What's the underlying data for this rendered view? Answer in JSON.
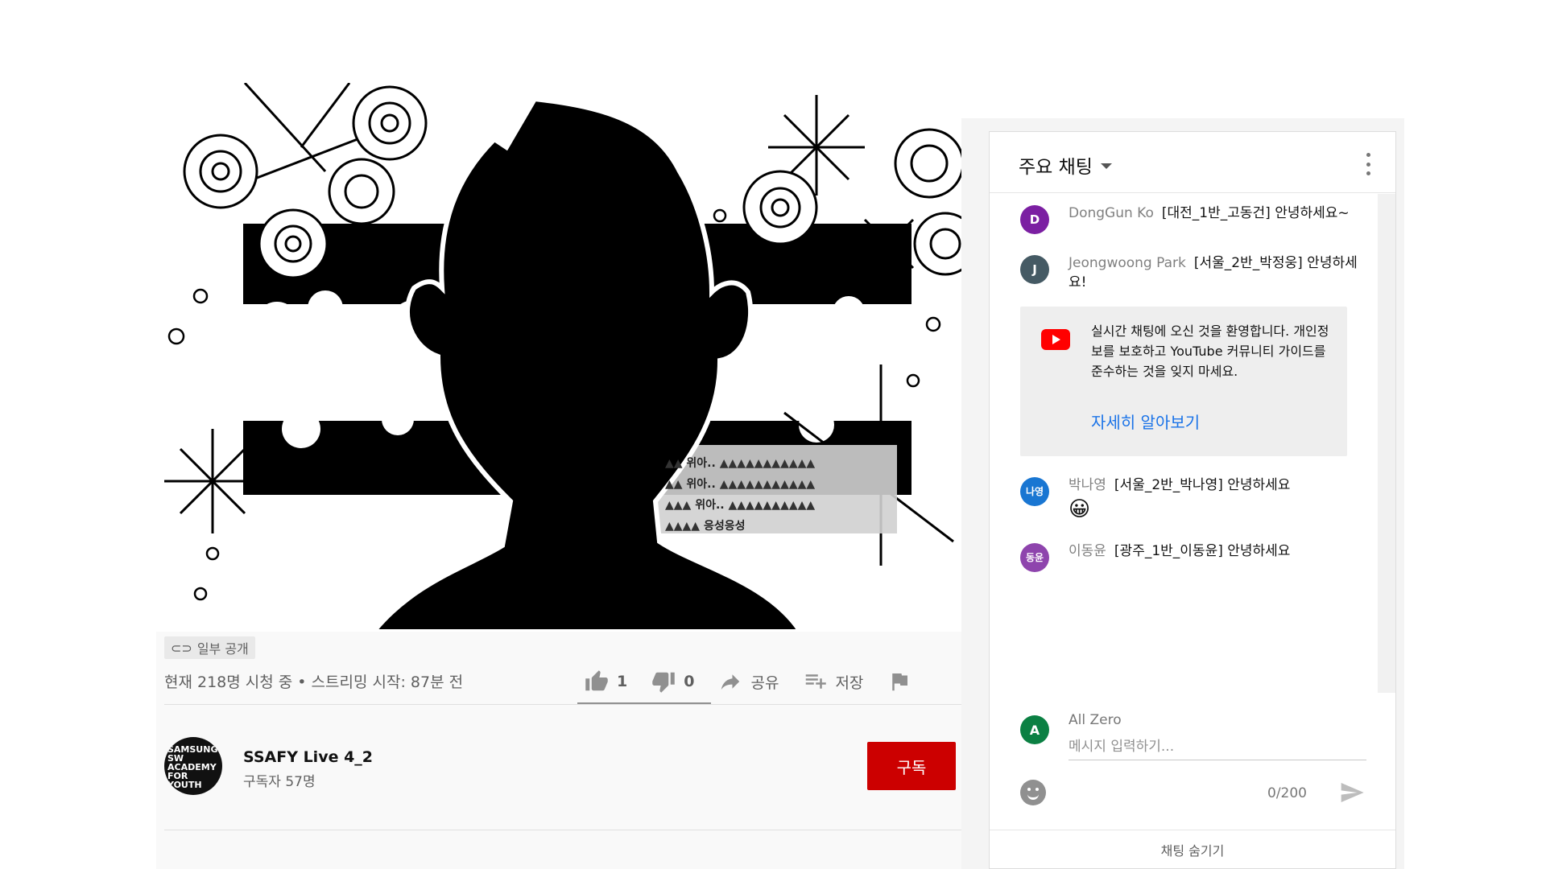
{
  "video": {
    "overlay_lines": [
      "위아..",
      "위아..",
      "위아..",
      "응성응성"
    ]
  },
  "info": {
    "visibility": "일부 공개",
    "viewers": "현재 218명 시청 중 • 스트리밍 시작: 87분 전",
    "like_count": "1",
    "dislike_count": "0",
    "share_label": "공유",
    "save_label": "저장"
  },
  "channel": {
    "avatar_text": "SAMSUNG SW ACADEMY FOR YOUTH",
    "name": "SSAFY Live 4_2",
    "subscribers": "구독자 57명",
    "subscribe_label": "구독"
  },
  "chat": {
    "title": "주요 채팅",
    "messages": [
      {
        "initial": "D",
        "color": "#7b1fa2",
        "author": "DongGun Ko",
        "text": "[대전_1반_고동건] 안녕하세요~"
      },
      {
        "initial": "J",
        "color": "#455a64",
        "author": "Jeongwoong Park",
        "text": "[서울_2반_박정웅] 안녕하세요!"
      },
      {
        "initial": "나영",
        "color": "#1976d2",
        "author": "박나영",
        "text": "[서울_2반_박나영] 안녕하세요",
        "emoji": "😀"
      },
      {
        "initial": "동윤",
        "color": "#8e44ad",
        "author": "이동윤",
        "text": "[광주_1반_이동윤] 안녕하세요"
      }
    ],
    "welcome": {
      "text": "실시간 채팅에 오신 것을 환영합니다. 개인정보를 보호하고 YouTube 커뮤니티 가이드를 준수하는 것을 잊지 마세요.",
      "learn_more": "자세히 알아보기"
    },
    "input": {
      "initial": "A",
      "author": "All Zero",
      "placeholder": "메시지 입력하기...",
      "counter": "0/200"
    },
    "hide_label": "채팅 숨기기"
  },
  "icons": [
    "link-icon",
    "thumbs-up-icon",
    "thumbs-down-icon",
    "share-icon",
    "save-playlist-icon",
    "flag-icon",
    "youtube-icon",
    "emoji-icon",
    "send-icon",
    "more-vert-icon",
    "chevron-down-icon"
  ],
  "colors": {
    "subscribe": "#cc0000",
    "link": "#1a73e8",
    "youtube_red": "#ff0000"
  }
}
